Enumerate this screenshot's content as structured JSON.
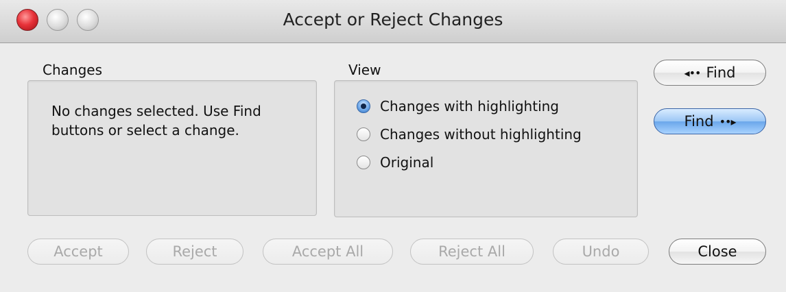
{
  "window": {
    "title": "Accept or Reject Changes"
  },
  "changes": {
    "label": "Changes",
    "message": "No changes selected. Use Find buttons or select a change."
  },
  "view": {
    "label": "View",
    "options": [
      {
        "label": "Changes with highlighting",
        "selected": true
      },
      {
        "label": "Changes without highlighting",
        "selected": false
      },
      {
        "label": "Original",
        "selected": false
      }
    ]
  },
  "find": {
    "prev_label": "Find",
    "next_label": "Find",
    "prev_arrow": "◂••",
    "next_arrow": "••▸"
  },
  "actions": {
    "accept": "Accept",
    "reject": "Reject",
    "accept_all": "Accept All",
    "reject_all": "Reject All",
    "undo": "Undo",
    "close": "Close"
  },
  "colors": {
    "default_button": "#6aa6ea",
    "close_light": "#e8333a"
  },
  "icons": {
    "prev": "arrow-left-dots-icon",
    "next": "arrow-right-dots-icon"
  }
}
